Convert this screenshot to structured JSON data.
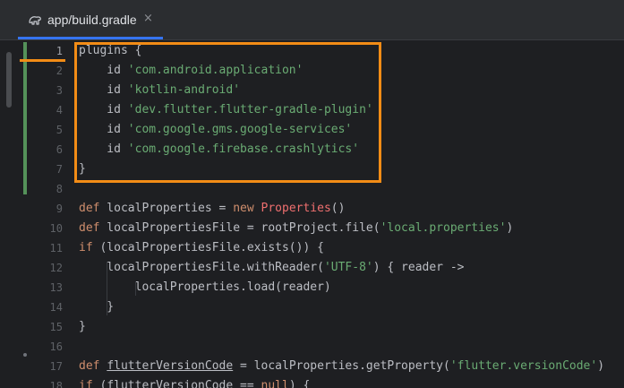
{
  "tab": {
    "label": "app/build.gradle",
    "close_glyph": "×",
    "icon": "gradle-elephant-icon"
  },
  "colors": {
    "accent": "#3574f0",
    "annotation": "#f28c16",
    "vcs_added": "#549159",
    "keyword": "#cf8e6d",
    "string": "#6aab73",
    "class": "#ef6f6f"
  },
  "editor": {
    "lines": [
      {
        "n": "1",
        "tokens": [
          {
            "t": "plugins {",
            "c": "plain"
          }
        ]
      },
      {
        "n": "2",
        "tokens": [
          {
            "t": "    id ",
            "c": "plain"
          },
          {
            "t": "'com.android.application'",
            "c": "str"
          }
        ]
      },
      {
        "n": "3",
        "tokens": [
          {
            "t": "    id ",
            "c": "plain"
          },
          {
            "t": "'kotlin-android'",
            "c": "str"
          }
        ]
      },
      {
        "n": "4",
        "tokens": [
          {
            "t": "    id ",
            "c": "plain"
          },
          {
            "t": "'dev.flutter.flutter-gradle-plugin'",
            "c": "str"
          }
        ]
      },
      {
        "n": "5",
        "tokens": [
          {
            "t": "    id ",
            "c": "plain"
          },
          {
            "t": "'com.google.gms.google-services'",
            "c": "str"
          }
        ]
      },
      {
        "n": "6",
        "tokens": [
          {
            "t": "    id ",
            "c": "plain"
          },
          {
            "t": "'com.google.firebase.crashlytics'",
            "c": "str"
          }
        ]
      },
      {
        "n": "7",
        "tokens": [
          {
            "t": "}",
            "c": "plain"
          }
        ]
      },
      {
        "n": "8",
        "tokens": []
      },
      {
        "n": "9",
        "tokens": [
          {
            "t": "def",
            "c": "kw"
          },
          {
            "t": " localProperties = ",
            "c": "plain"
          },
          {
            "t": "new",
            "c": "kw"
          },
          {
            "t": " ",
            "c": "plain"
          },
          {
            "t": "Properties",
            "c": "cls"
          },
          {
            "t": "()",
            "c": "plain"
          }
        ]
      },
      {
        "n": "10",
        "tokens": [
          {
            "t": "def",
            "c": "kw"
          },
          {
            "t": " localPropertiesFile = rootProject.file(",
            "c": "plain"
          },
          {
            "t": "'local.properties'",
            "c": "str"
          },
          {
            "t": ")",
            "c": "plain"
          }
        ]
      },
      {
        "n": "11",
        "tokens": [
          {
            "t": "if",
            "c": "kw"
          },
          {
            "t": " (localPropertiesFile.exists()) {",
            "c": "plain"
          }
        ]
      },
      {
        "n": "12",
        "tokens": [
          {
            "t": "    localPropertiesFile.withReader(",
            "c": "plain"
          },
          {
            "t": "'UTF-8'",
            "c": "str"
          },
          {
            "t": ") { reader ->",
            "c": "plain"
          }
        ]
      },
      {
        "n": "13",
        "tokens": [
          {
            "t": "        localProperties.load(reader)",
            "c": "plain"
          }
        ]
      },
      {
        "n": "14",
        "tokens": [
          {
            "t": "    }",
            "c": "plain"
          }
        ]
      },
      {
        "n": "15",
        "tokens": [
          {
            "t": "}",
            "c": "plain"
          }
        ]
      },
      {
        "n": "16",
        "tokens": []
      },
      {
        "n": "17",
        "tokens": [
          {
            "t": "def",
            "c": "kw"
          },
          {
            "t": " ",
            "c": "plain"
          },
          {
            "t": "flutterVersionCode",
            "c": "def"
          },
          {
            "t": " = localProperties.getProperty(",
            "c": "plain"
          },
          {
            "t": "'flutter.versionCode'",
            "c": "str"
          },
          {
            "t": ")",
            "c": "plain"
          }
        ]
      },
      {
        "n": "18",
        "tokens": [
          {
            "t": "if",
            "c": "kw"
          },
          {
            "t": " (",
            "c": "plain"
          },
          {
            "t": "flutterVersionCode",
            "c": "def"
          },
          {
            "t": " == ",
            "c": "plain"
          },
          {
            "t": "null",
            "c": "kw"
          },
          {
            "t": ") {",
            "c": "plain"
          }
        ]
      }
    ]
  }
}
